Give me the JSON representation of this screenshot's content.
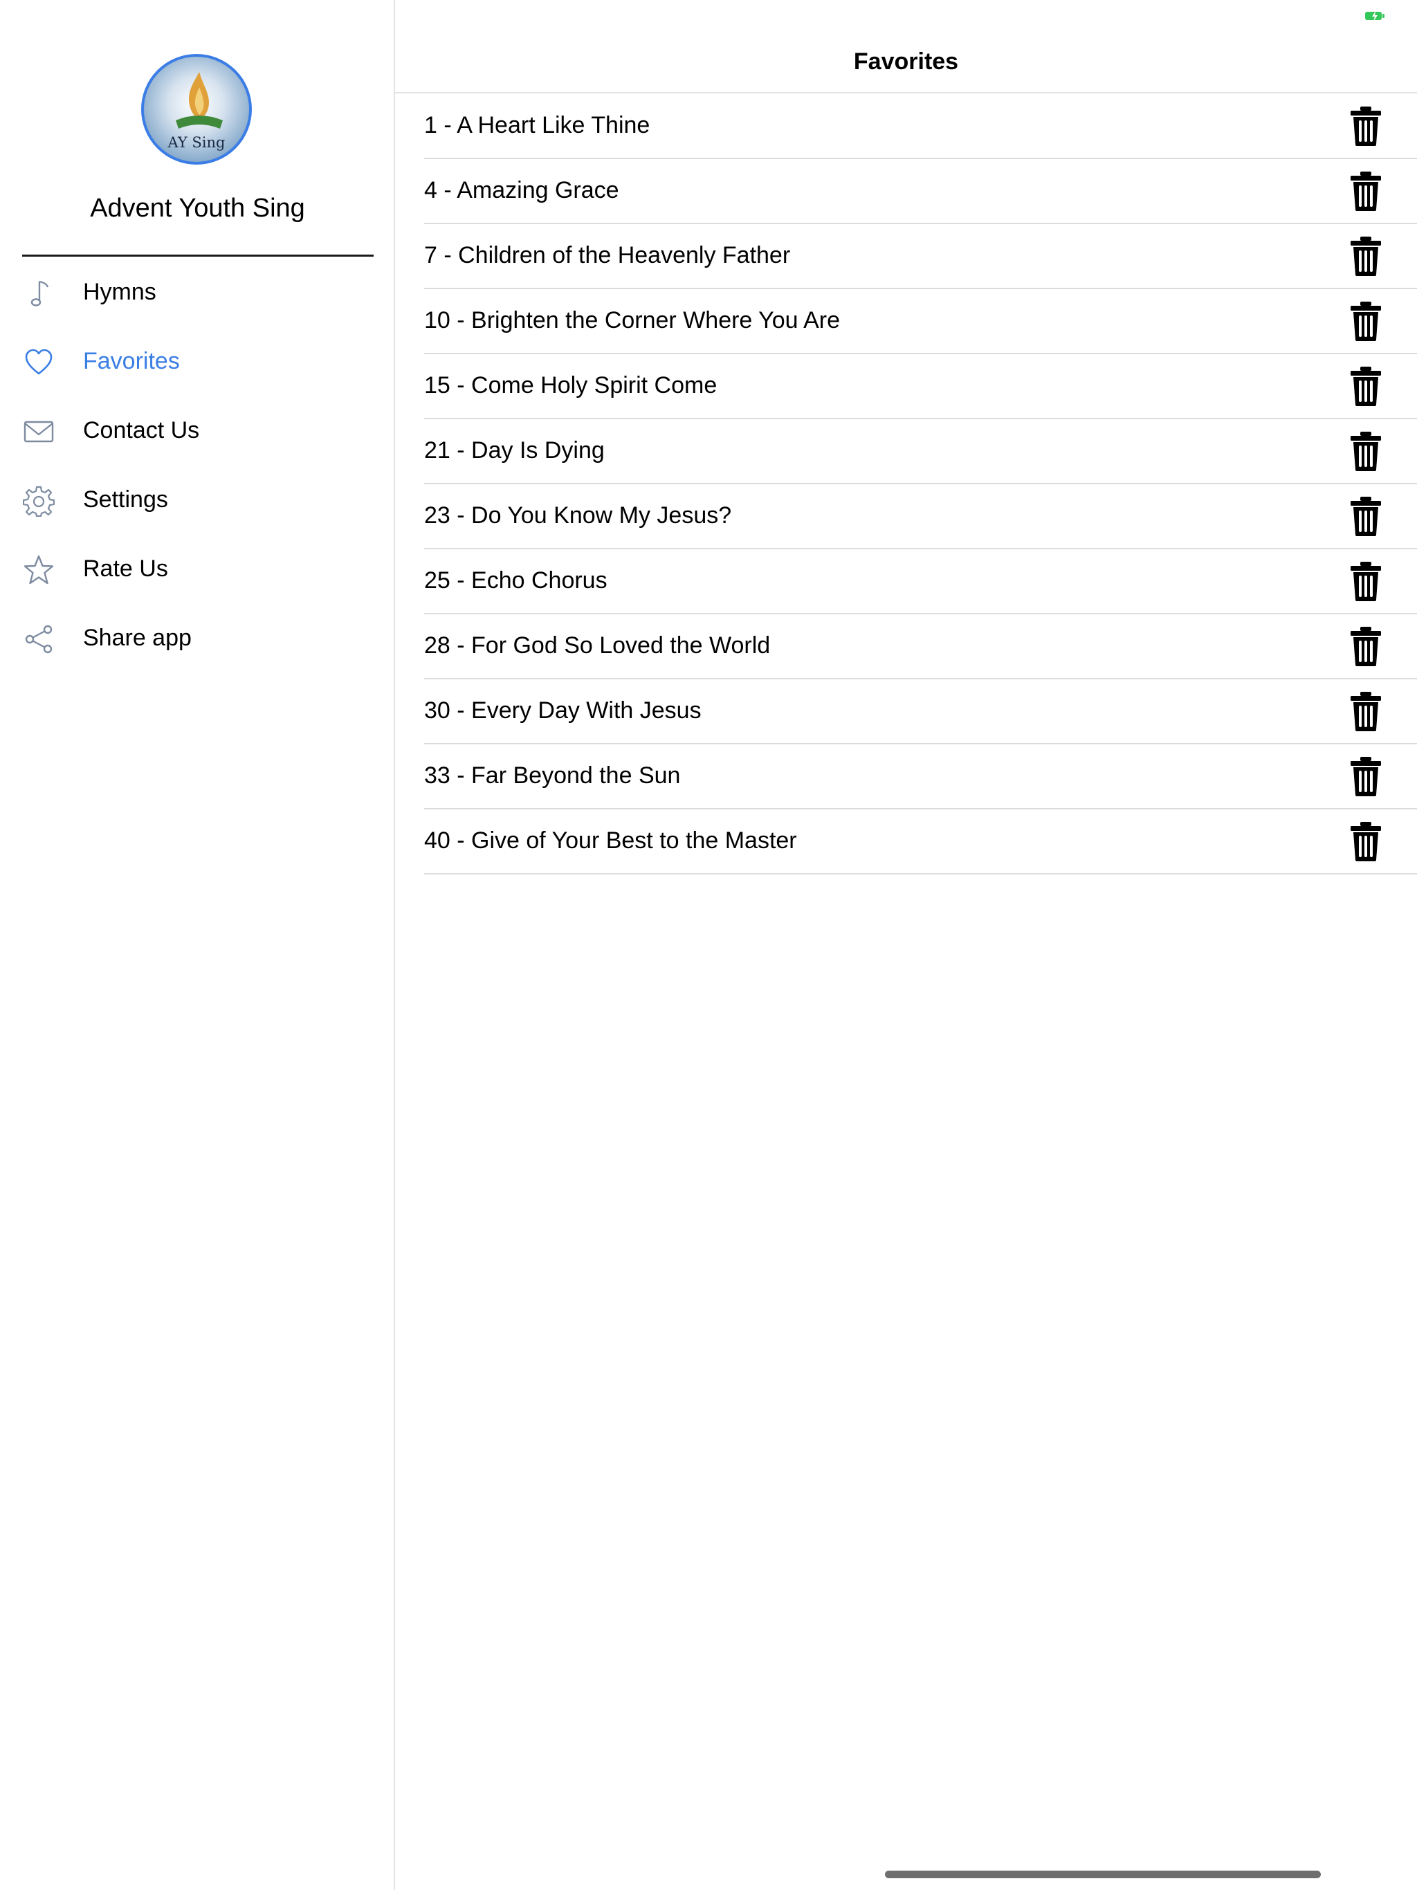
{
  "sidebar": {
    "logo_text": "AY Sing",
    "app_name": "Advent Youth Sing",
    "items": [
      {
        "label": "Hymns",
        "icon": "music-note-icon",
        "active": false
      },
      {
        "label": "Favorites",
        "icon": "heart-icon",
        "active": true
      },
      {
        "label": "Contact Us",
        "icon": "envelope-icon",
        "active": false
      },
      {
        "label": "Settings",
        "icon": "gear-icon",
        "active": false
      },
      {
        "label": "Rate Us",
        "icon": "star-icon",
        "active": false
      },
      {
        "label": "Share app",
        "icon": "share-icon",
        "active": false
      }
    ]
  },
  "main": {
    "title": "Favorites",
    "favorites": [
      "1 - A Heart Like Thine",
      "4 - Amazing Grace",
      "7 - Children of the Heavenly Father",
      "10 - Brighten the Corner Where You Are",
      "15 - Come Holy Spirit Come",
      "21 - Day Is Dying",
      "23 - Do You Know My Jesus?",
      "25 - Echo Chorus",
      "28 - For God So Loved the World",
      "30 - Every Day With Jesus",
      "33 - Far Beyond the Sun",
      "40 - Give of Your Best to the Master"
    ],
    "row_action_icon": "trash-icon"
  },
  "colors": {
    "accent": "#3a7ee4",
    "menu_icon": "#7d8ba0",
    "battery": "#34c759"
  }
}
